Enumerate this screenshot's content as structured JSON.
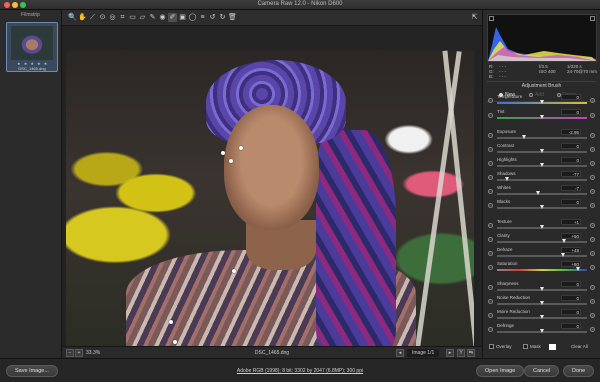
{
  "window": {
    "title": "Camera Raw 12.0  -  Nikon D600"
  },
  "filmstrip": {
    "label": "Filmstrip",
    "thumb_name": "DSC_1465.dng",
    "stars": "★ ★ ★ ★ ★"
  },
  "toolbar": {
    "tools": [
      "zoom-tool",
      "hand-tool",
      "white-balance-tool",
      "color-sampler-tool",
      "targeted-adjustment-tool",
      "crop-tool",
      "straighten-tool",
      "transform-tool",
      "spot-removal-tool",
      "red-eye-tool",
      "adjustment-brush-tool",
      "graduated-filter-tool",
      "radial-filter-tool",
      "preferences-tool",
      "rotate-left-tool",
      "rotate-right-tool",
      "trash-tool"
    ],
    "glyphs": [
      "🔍",
      "✋",
      "⟋",
      "⊙",
      "◎",
      "⌗",
      "▭",
      "▱",
      "✎",
      "◉",
      "✐",
      "▣",
      "◯",
      "≡",
      "↺",
      "↻",
      "🗑"
    ]
  },
  "canvas": {
    "zoom": "33.3%",
    "filename": "DSC_1465.dng",
    "image_count": "Image 1/1"
  },
  "readout": {
    "r": "R:",
    "g": "G:",
    "b": "B:",
    "dashes": "- - -",
    "aperture": "f/3.5",
    "shutter": "1/320 s",
    "iso": "ISO 400",
    "lens": "24-70@70 mm"
  },
  "panel": {
    "title": "Adjustment Brush",
    "modes": [
      "New",
      "Add",
      "Erase"
    ],
    "adjustments": [
      {
        "label": "Temperature",
        "value": "0",
        "knob": 0.5
      },
      {
        "label": "Tint",
        "value": "0",
        "knob": 0.5
      },
      {
        "label": "Exposure",
        "value": "-2.95",
        "knob": 0.3
      },
      {
        "label": "Contrast",
        "value": "0",
        "knob": 0.5
      },
      {
        "label": "Highlights",
        "value": "0",
        "knob": 0.5
      },
      {
        "label": "Shadows",
        "value": "-77",
        "knob": 0.12
      },
      {
        "label": "Whites",
        "value": "-7",
        "knob": 0.46
      },
      {
        "label": "Blacks",
        "value": "0",
        "knob": 0.5
      },
      {
        "label": "Texture",
        "value": "+1",
        "knob": 0.51
      },
      {
        "label": "Clarity",
        "value": "+50",
        "knob": 0.75
      },
      {
        "label": "Dehaze",
        "value": "+48",
        "knob": 0.74
      },
      {
        "label": "Saturation",
        "value": "+80",
        "knob": 0.9
      },
      {
        "label": "Sharpness",
        "value": "0",
        "knob": 0.5
      },
      {
        "label": "Noise Reduction",
        "value": "0",
        "knob": 0.5
      },
      {
        "label": "Moire Reduction",
        "value": "0",
        "knob": 0.5
      },
      {
        "label": "Defringe",
        "value": "0",
        "knob": 0.5
      }
    ],
    "overlay": "Overlay",
    "mask": "Mask",
    "clear_all": "Clear All"
  },
  "footer": {
    "save_image": "Save Image...",
    "workflow": "Adobe RGB (1998); 8 bit; 3302 by 2047 (6.8MP); 300 ppi",
    "open_image": "Open Image",
    "cancel": "Cancel",
    "done": "Done"
  }
}
